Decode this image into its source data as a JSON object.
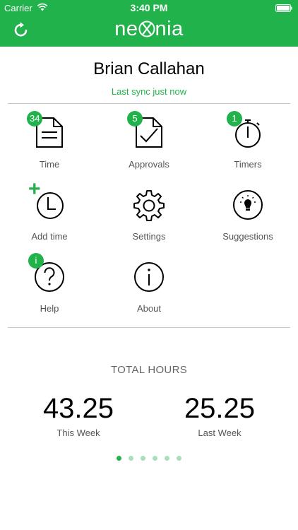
{
  "status_bar": {
    "carrier": "Carrier",
    "time": "3:40 PM"
  },
  "header": {
    "logo_left": "ne",
    "logo_right": "nia",
    "logo_icon": "x-logo-icon",
    "refresh_icon": "refresh-icon"
  },
  "user": {
    "name": "Brian Callahan",
    "sync": "Last sync just now"
  },
  "tiles": [
    {
      "label": "Time",
      "badge": "34",
      "icon": "document-icon"
    },
    {
      "label": "Approvals",
      "badge": "5",
      "icon": "approval-document-icon"
    },
    {
      "label": "Timers",
      "badge": "1",
      "icon": "stopwatch-icon"
    },
    {
      "label": "Add time",
      "badge": "+",
      "icon": "add-time-clock-icon"
    },
    {
      "label": "Settings",
      "badge": "",
      "icon": "gear-icon"
    },
    {
      "label": "Suggestions",
      "badge": "",
      "icon": "lightbulb-icon"
    },
    {
      "label": "Help",
      "badge": "i",
      "icon": "question-icon"
    },
    {
      "label": "About",
      "badge": "",
      "icon": "info-icon"
    }
  ],
  "totals": {
    "title": "TOTAL HOURS",
    "this_week": {
      "value": "43.25",
      "label": "This Week"
    },
    "last_week": {
      "value": "25.25",
      "label": "Last Week"
    }
  },
  "pager": {
    "count": 6,
    "active": 0
  },
  "colors": {
    "brand": "#21b24b",
    "dot_inactive": "#a8e0b8"
  }
}
